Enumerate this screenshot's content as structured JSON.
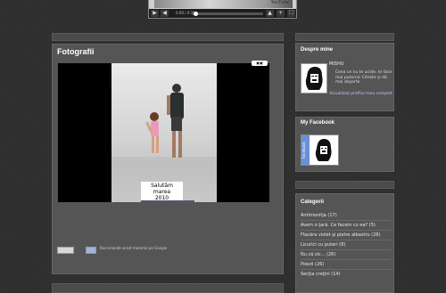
{
  "player": {
    "youtube_label": "YouTube",
    "time": "0:00 / 0:36",
    "play_icon": "play-icon",
    "volume_icon": "volume-icon"
  },
  "main": {
    "title": "Fotografii",
    "photo_caption_line1": "Salutăm marea",
    "photo_caption_line2": "2010",
    "share_text": "Recomandă acest material pe Google"
  },
  "about": {
    "title": "Despre mine",
    "name": "MISHU",
    "description": "Ceea ce nu te ucide, te face mai puternic Citește și dă mai departe",
    "profile_link": "Vizualizaţi profilul meu complet"
  },
  "facebook": {
    "title": "My Facebook",
    "side_label": "Facebook"
  },
  "categories": {
    "title": "Categorii",
    "items": [
      {
        "label": "Antimonitja (17)"
      },
      {
        "label": "Avem o ţară. Ce facem cu ea? (5)"
      },
      {
        "label": "Flacăra violet şi pietre albastru (28)"
      },
      {
        "label": "Licurici cu puteri (8)"
      },
      {
        "label": "Nu că zic... (26)"
      },
      {
        "label": "Poezii (26)"
      },
      {
        "label": "Secţia creţini (14)"
      }
    ]
  },
  "colors": {
    "background": "#2d2d2d",
    "panel": "#555555",
    "link": "#b9c9ff"
  }
}
